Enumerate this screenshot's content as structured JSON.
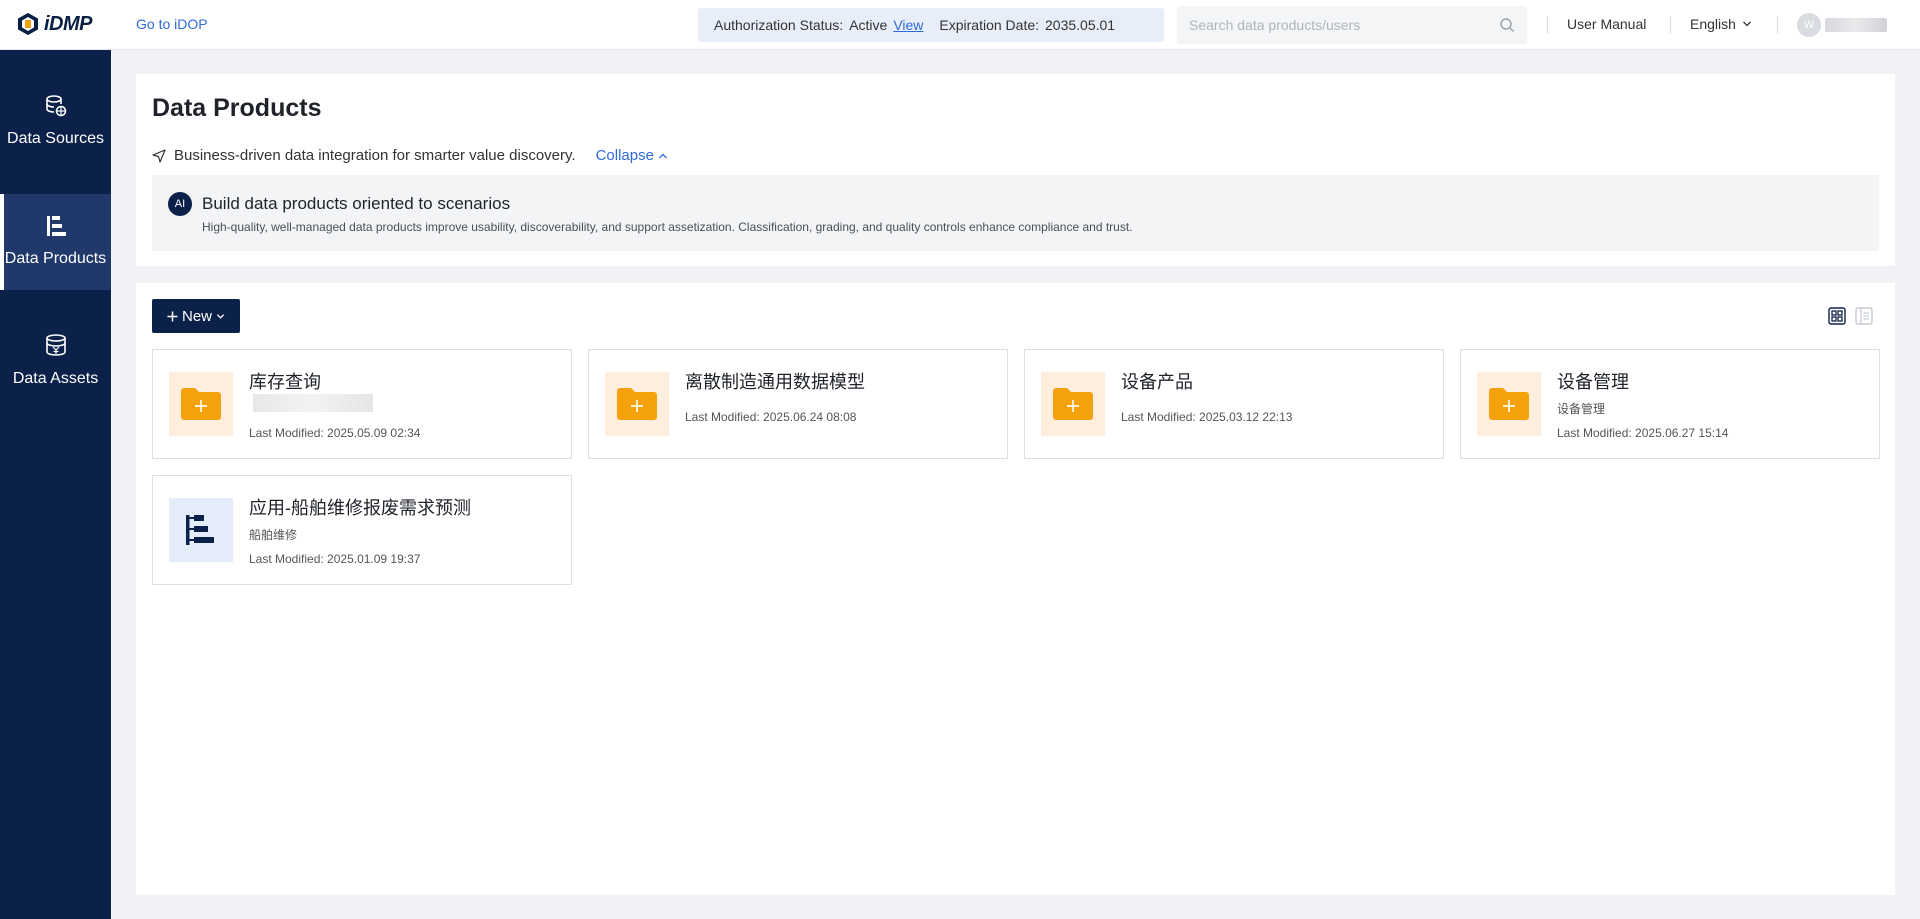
{
  "topbar": {
    "logo_text": "iDMP",
    "goto_link": "Go to iDOP",
    "auth_label": "Authorization Status:",
    "auth_status": "Active",
    "auth_view": "View",
    "expiration_label": "Expiration Date:",
    "expiration_date": "2035.05.01",
    "search_placeholder": "Search data products/users",
    "user_manual": "User Manual",
    "language": "English",
    "avatar_initial": "W"
  },
  "sidebar": {
    "items": [
      {
        "label": "Data Sources",
        "icon": "database-icon"
      },
      {
        "label": "Data Products",
        "icon": "tree-structure-icon",
        "active": true
      },
      {
        "label": "Data Assets",
        "icon": "coin-stack-icon"
      }
    ]
  },
  "header": {
    "title": "Data Products",
    "tagline": "Business-driven data integration for smarter value discovery.",
    "collapse": "Collapse",
    "ai_badge": "AI",
    "info_title": "Build data products oriented to scenarios",
    "info_desc": "High-quality, well-managed data products improve usability, discoverability, and support assetization. Classification, grading, and quality controls enhance compliance and trust."
  },
  "toolbar": {
    "new_label": "New"
  },
  "cards": [
    {
      "title": "库存查询",
      "subtitle": "",
      "date": "Last Modified: 2025.05.09 02:34",
      "icon": "folder-plus-icon"
    },
    {
      "title": "离散制造通用数据模型",
      "subtitle": "",
      "date": "Last Modified: 2025.06.24 08:08",
      "icon": "folder-plus-icon"
    },
    {
      "title": "设备产品",
      "subtitle": "",
      "date": "Last Modified: 2025.03.12 22:13",
      "icon": "folder-plus-icon"
    },
    {
      "title": "设备管理",
      "subtitle": "设备管理",
      "date": "Last Modified: 2025.06.27 15:14",
      "icon": "folder-plus-icon"
    },
    {
      "title": "应用-船舶维修报废需求预测",
      "subtitle": "船舶维修",
      "date": "Last Modified: 2025.01.09 19:37",
      "icon": "tree-structure-icon"
    }
  ],
  "colors": {
    "primary": "#0b2149",
    "link": "#2f6bd8",
    "folder": "#f5a20a",
    "folder_bg": "#fdeede"
  }
}
